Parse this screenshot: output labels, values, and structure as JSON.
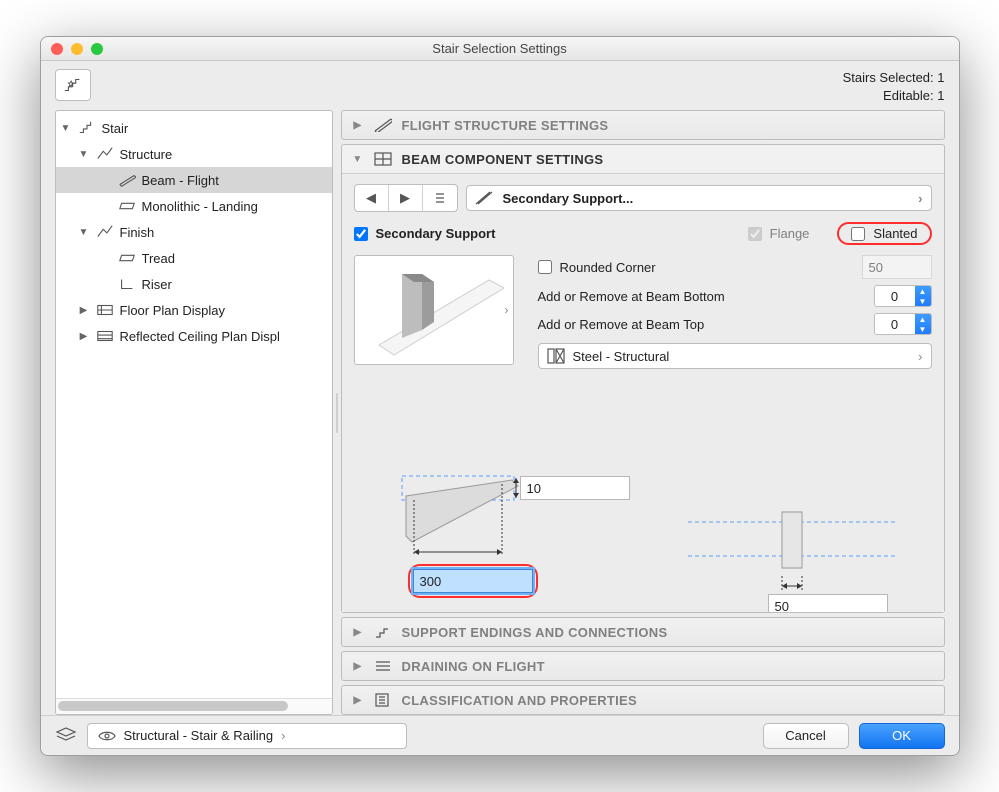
{
  "window": {
    "title": "Stair Selection Settings"
  },
  "status": {
    "selected_label": "Stairs Selected:",
    "selected_count": "1",
    "editable_label": "Editable:",
    "editable_count": "1"
  },
  "tree": {
    "stair": "Stair",
    "structure": "Structure",
    "beam_flight": "Beam - Flight",
    "mono_landing": "Monolithic - Landing",
    "finish": "Finish",
    "tread": "Tread",
    "riser": "Riser",
    "floor_plan": "Floor Plan Display",
    "rcp": "Reflected Ceiling Plan Displ"
  },
  "sections": {
    "flight_structure": "FLIGHT STRUCTURE SETTINGS",
    "beam_component": "BEAM COMPONENT SETTINGS",
    "support_endings": "SUPPORT ENDINGS AND CONNECTIONS",
    "draining": "DRAINING ON FLIGHT",
    "classification": "CLASSIFICATION AND PROPERTIES"
  },
  "beam": {
    "nav_label": "Secondary Support...",
    "secondary_support": "Secondary Support",
    "flange": "Flange",
    "slanted": "Slanted",
    "rounded_corner": "Rounded Corner",
    "rounded_val": "50",
    "add_bottom": "Add or Remove at Beam Bottom",
    "add_top": "Add or Remove at Beam Top",
    "bottom_val": "0",
    "top_val": "0",
    "material": "Steel - Structural",
    "dim_side_top": "10",
    "dim_side_main": "300",
    "dim_front": "50"
  },
  "footer": {
    "layer": "Structural - Stair & Railing",
    "cancel": "Cancel",
    "ok": "OK"
  }
}
